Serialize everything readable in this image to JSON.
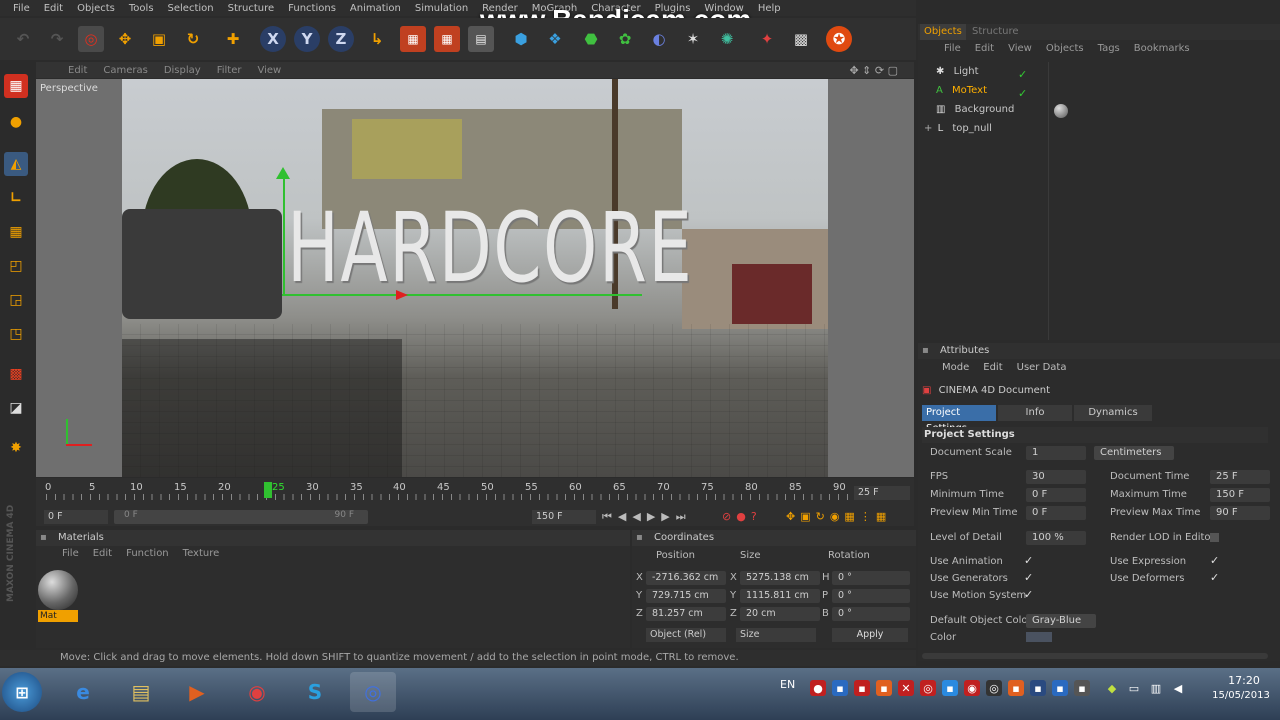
{
  "menubar": {
    "items": [
      "File",
      "Edit",
      "Objects",
      "Tools",
      "Selection",
      "Structure",
      "Functions",
      "Animation",
      "Simulation",
      "Render",
      "MoGraph",
      "Character",
      "Plugins",
      "Window",
      "Help"
    ]
  },
  "watermark": "www.Bandicam.com",
  "viewport": {
    "menu": [
      "Edit",
      "Cameras",
      "Display",
      "Filter",
      "View"
    ],
    "label": "Perspective",
    "scene_text": "HARDCORE"
  },
  "timeline": {
    "ticks": [
      "0",
      "5",
      "10",
      "15",
      "20",
      "25",
      "30",
      "35",
      "40",
      "45",
      "50",
      "55",
      "60",
      "65",
      "70",
      "75",
      "80",
      "85",
      "90"
    ],
    "current_frame_label": "25",
    "fps_display": "25 F",
    "start_field": "0 F",
    "range_start": "0 F",
    "range_end": "90 F",
    "end_field": "150 F"
  },
  "materials": {
    "title": "Materials",
    "menu": [
      "File",
      "Edit",
      "Function",
      "Texture"
    ],
    "items": [
      {
        "name": "Mat"
      }
    ]
  },
  "coordinates": {
    "title": "Coordinates",
    "headers": [
      "Position",
      "Size",
      "Rotation"
    ],
    "rows": [
      {
        "axis": "X",
        "pos": "-2716.362 cm",
        "saxis": "X",
        "size": "5275.138 cm",
        "raxis": "H",
        "rot": "0 °"
      },
      {
        "axis": "Y",
        "pos": "729.715 cm",
        "saxis": "Y",
        "size": "1115.811 cm",
        "raxis": "P",
        "rot": "0 °"
      },
      {
        "axis": "Z",
        "pos": "81.257 cm",
        "saxis": "Z",
        "size": "20 cm",
        "raxis": "B",
        "rot": "0 °"
      }
    ],
    "mode_select": "Object (Rel)",
    "size_select": "Size",
    "apply_label": "Apply"
  },
  "objects_panel": {
    "tabs": [
      "Objects",
      "Structure"
    ],
    "menu": [
      "File",
      "Edit",
      "View",
      "Objects",
      "Tags",
      "Bookmarks"
    ],
    "items": [
      {
        "name": "Light",
        "color": "#c8c8c8"
      },
      {
        "name": "MoText",
        "color": "#ffb000"
      },
      {
        "name": "Background",
        "color": "#c8c8c8"
      },
      {
        "name": "top_null",
        "color": "#c8c8c8"
      }
    ]
  },
  "attributes": {
    "title": "Attributes",
    "menu": [
      "Mode",
      "Edit",
      "User Data"
    ],
    "doc_title": "CINEMA 4D Document",
    "tabs": [
      "Project Settings",
      "Info",
      "Dynamics"
    ],
    "section": "Project Settings",
    "document_scale_label": "Document Scale",
    "document_scale_value": "1",
    "document_scale_unit": "Centimeters",
    "fps_label": "FPS",
    "fps_value": "30",
    "document_time_label": "Document Time",
    "document_time_value": "25 F",
    "min_time_label": "Minimum Time",
    "min_time_value": "0 F",
    "max_time_label": "Maximum Time",
    "max_time_value": "150 F",
    "preview_min_label": "Preview Min Time",
    "preview_min_value": "0 F",
    "preview_max_label": "Preview Max Time",
    "preview_max_value": "90 F",
    "lod_label": "Level of Detail",
    "lod_value": "100 %",
    "render_lod_label": "Render LOD in Editor",
    "use_animation_label": "Use Animation",
    "use_expression_label": "Use Expression",
    "use_generators_label": "Use Generators",
    "use_deformers_label": "Use Deformers",
    "use_motion_label": "Use Motion System",
    "default_color_label": "Default Object Color",
    "default_color_value": "Gray-Blue",
    "color_label": "Color"
  },
  "statusbar": {
    "text": "Move: Click and drag to move elements. Hold down SHIFT to quantize movement / add to the selection in point mode, CTRL to remove."
  },
  "taskbar": {
    "lang": "EN",
    "time": "17:20",
    "date": "15/05/2013"
  },
  "branding": "MAXON CINEMA 4D"
}
